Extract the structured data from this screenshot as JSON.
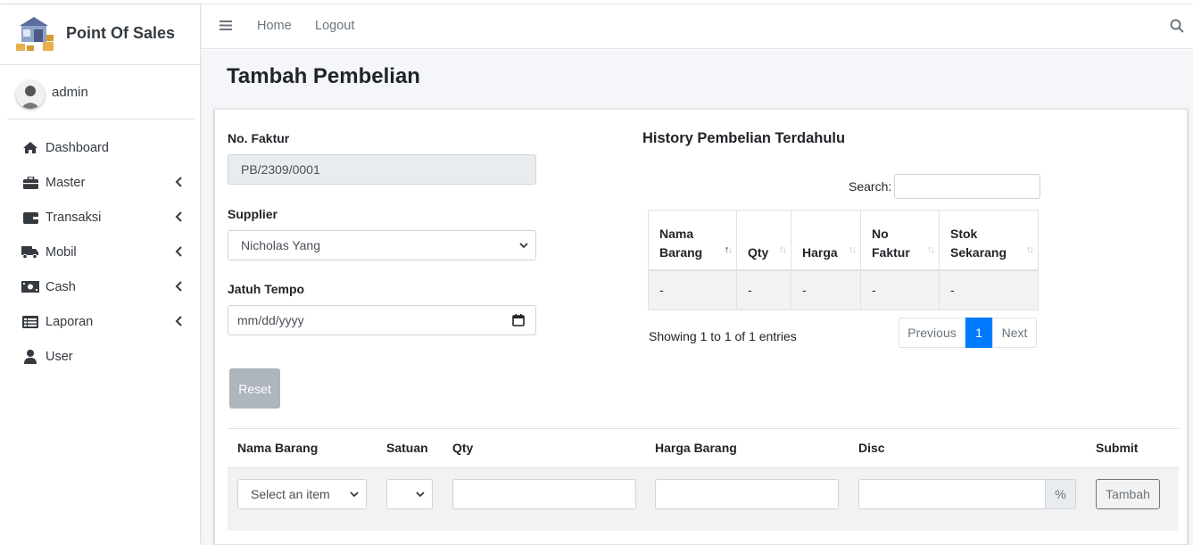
{
  "app": {
    "brand": "Point Of Sales",
    "user": "admin"
  },
  "sidebar": {
    "items": [
      {
        "label": "Dashboard",
        "icon": "home-icon",
        "has_arrow": false
      },
      {
        "label": "Master",
        "icon": "briefcase-icon",
        "has_arrow": true
      },
      {
        "label": "Transaksi",
        "icon": "wallet-icon",
        "has_arrow": true
      },
      {
        "label": "Mobil",
        "icon": "truck-icon",
        "has_arrow": true
      },
      {
        "label": "Cash",
        "icon": "money-bill-icon",
        "has_arrow": true
      },
      {
        "label": "Laporan",
        "icon": "list-icon",
        "has_arrow": true
      },
      {
        "label": "User",
        "icon": "user-icon",
        "has_arrow": false
      }
    ]
  },
  "navbar": {
    "home": "Home",
    "logout": "Logout"
  },
  "page": {
    "title": "Tambah Pembelian"
  },
  "form": {
    "faktur_label": "No. Faktur",
    "faktur_value": "PB/2309/0001",
    "supplier_label": "Supplier",
    "supplier_value": "Nicholas Yang",
    "tempo_label": "Jatuh Tempo",
    "tempo_placeholder": "mm/dd/yyyy",
    "reset_label": "Reset"
  },
  "history": {
    "title": "History Pembelian Terdahulu",
    "search_label": "Search:",
    "columns": [
      "Nama Barang",
      "Qty",
      "Harga",
      "No Faktur",
      "Stok Sekarang"
    ],
    "rows": [
      [
        "-",
        "-",
        "-",
        "-",
        "-"
      ]
    ],
    "showing": "Showing 1 to 1 of 1 entries",
    "prev": "Previous",
    "page": "1",
    "next": "Next"
  },
  "items": {
    "headers": {
      "nama": "Nama Barang",
      "satuan": "Satuan",
      "qty": "Qty",
      "harga": "Harga Barang",
      "disc": "Disc",
      "submit": "Submit"
    },
    "select_placeholder": "Select an item",
    "percent": "%",
    "add_label": "Tambah"
  },
  "colors": {
    "primary": "#007bff",
    "reset_btn": "#adb5bd",
    "content_bg": "#f4f6f9"
  }
}
